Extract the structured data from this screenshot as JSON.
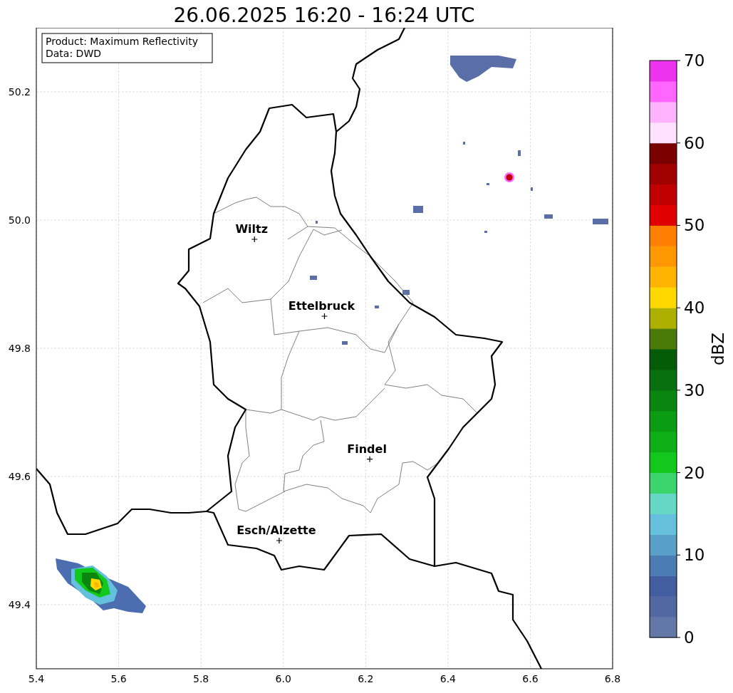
{
  "title": "26.06.2025 16:20 - 16:24 UTC",
  "info_box": [
    "Product: Maximum Reflectivity",
    "Data: DWD"
  ],
  "map": {
    "xticks": [
      "5.4",
      "5.6",
      "5.8",
      "6.0",
      "6.2",
      "6.4",
      "6.6",
      "6.8"
    ],
    "yticks": [
      "50.2",
      "50.0",
      "49.8",
      "49.6",
      "49.4"
    ],
    "cities": [
      {
        "name": "Wiltz"
      },
      {
        "name": "Ettelbruck"
      },
      {
        "name": "Findel"
      },
      {
        "name": "Esch/Alzette"
      }
    ]
  },
  "colorbar": {
    "label": "dBZ",
    "ticks": [
      "70",
      "60",
      "50",
      "40",
      "30",
      "20",
      "10",
      "0"
    ],
    "bins": [
      {
        "color": "#6478a8"
      },
      {
        "color": "#5268a0"
      },
      {
        "color": "#425ea0"
      },
      {
        "color": "#4c7cb4"
      },
      {
        "color": "#58a0c8"
      },
      {
        "color": "#64c0dc"
      },
      {
        "color": "#64d8c4"
      },
      {
        "color": "#3cd46c"
      },
      {
        "color": "#12c81c"
      },
      {
        "color": "#0eb018"
      },
      {
        "color": "#0c9c14"
      },
      {
        "color": "#0a8610"
      },
      {
        "color": "#08700e"
      },
      {
        "color": "#055c08"
      },
      {
        "color": "#4a7a08"
      },
      {
        "color": "#aeb000"
      },
      {
        "color": "#ffd800"
      },
      {
        "color": "#ffb400"
      },
      {
        "color": "#ff9800"
      },
      {
        "color": "#ff7f00"
      },
      {
        "color": "#e00000"
      },
      {
        "color": "#c00000"
      },
      {
        "color": "#a00000"
      },
      {
        "color": "#7a0000"
      },
      {
        "color": "#ffe0ff"
      },
      {
        "color": "#ffb3ff"
      },
      {
        "color": "#ff66ff"
      },
      {
        "color": "#ee33ee"
      }
    ]
  }
}
